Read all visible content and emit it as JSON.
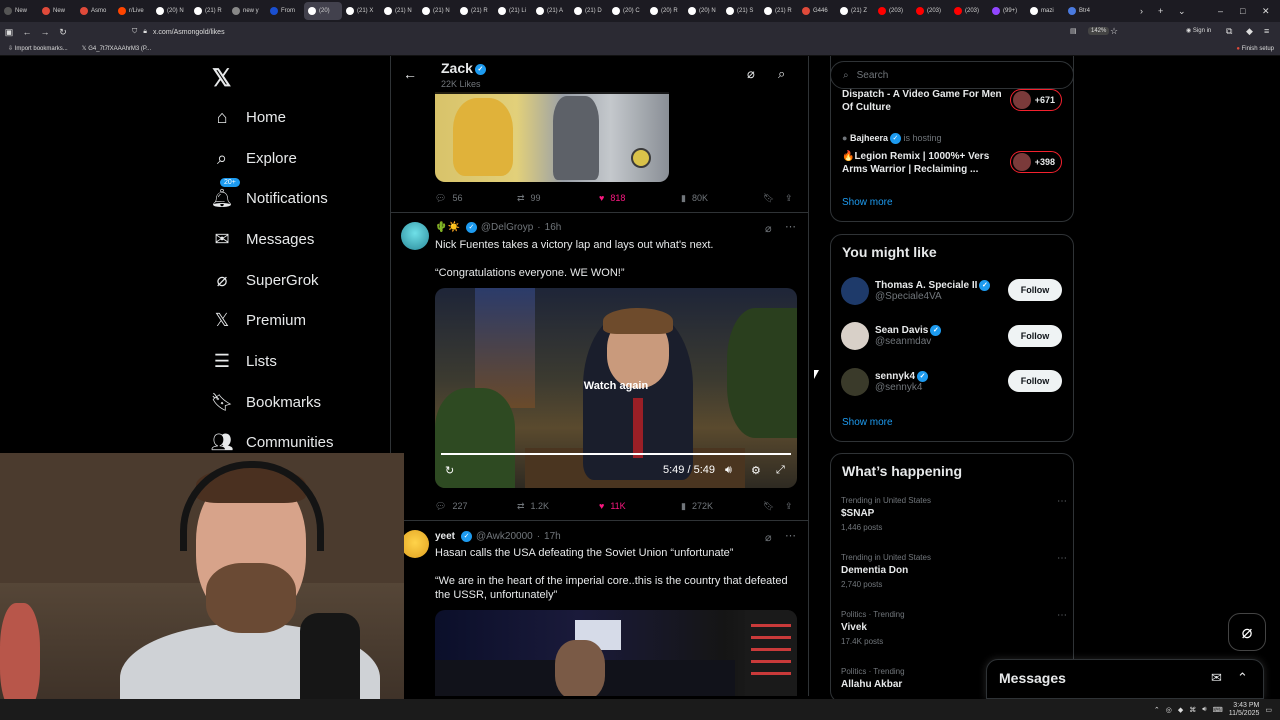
{
  "browser": {
    "tabs": [
      "New",
      "New",
      "Asmo",
      "r/Live",
      "(20) N",
      "(21) R",
      "new y",
      "From",
      "(20)",
      "(21) X",
      "(21) N",
      "(21) N",
      "(21) R",
      "(21) Li",
      "(21) A",
      "(21) D",
      "(20) C",
      "(20) R",
      "(20) N",
      "(21) S",
      "(21) R",
      "G446",
      "(21) Z",
      "(203)",
      "(203)",
      "(203)",
      "(99+)",
      "mazi",
      "Btr4"
    ],
    "url": "x.com/Asmongold/likes",
    "zoom": "142%",
    "sign_in": "Sign in",
    "bookmarks": [
      "Import bookmarks...",
      "G4_7t7fXAAAhrM3 (P..."
    ],
    "finish_setup": "Finish setup"
  },
  "nav": {
    "items": [
      {
        "label": "Home",
        "icon": "home-icon"
      },
      {
        "label": "Explore",
        "icon": "search-icon"
      },
      {
        "label": "Notifications",
        "icon": "bell-icon"
      },
      {
        "label": "Messages",
        "icon": "mail-icon"
      },
      {
        "label": "SuperGrok",
        "icon": "grok-icon"
      },
      {
        "label": "Premium",
        "icon": "x-icon"
      },
      {
        "label": "Lists",
        "icon": "list-icon"
      },
      {
        "label": "Bookmarks",
        "icon": "bookmark-icon"
      },
      {
        "label": "Communities",
        "icon": "people-icon"
      }
    ],
    "notif_badge": "20+"
  },
  "header": {
    "name": "Zack",
    "likes": "22K Likes"
  },
  "tweet0": {
    "replies": "56",
    "retweets": "99",
    "likes": "818",
    "views": "80K"
  },
  "tweet1": {
    "emoji": "🌵☀️",
    "handle": "@DelGroyp",
    "time": "16h",
    "text": "Nick Fuentes takes a victory lap and lays out what's next.",
    "quote": "“Congratulations everyone. WE WON!”",
    "video_overlay": "Watch again",
    "video_time": "5:49 / 5:49",
    "replies": "227",
    "retweets": "1.2K",
    "likes": "11K",
    "views": "272K"
  },
  "tweet2": {
    "name": "yeet",
    "handle": "@Awk20000",
    "time": "17h",
    "text": "Hasan calls the USA defeating the Soviet Union “unfortunate”",
    "quote": "“We are in the heart of the imperial core..this is the country that defeated the USSR, unfortunately”"
  },
  "right": {
    "search_placeholder": "Search",
    "space1": {
      "title": "Dispatch - A Video Game For Men Of Culture",
      "count": "+671"
    },
    "space2": {
      "host": "Bajheera",
      "hosting": "is hosting",
      "title": "🔥Legion Remix | 1000%+ Vers Arms Warrior | Reclaiming ...",
      "count": "+398"
    },
    "show_more": "Show more",
    "wtf_title": "You might like",
    "wtf": [
      {
        "name": "Thomas A. Speciale II",
        "handle": "@Speciale4VA",
        "follow": "Follow"
      },
      {
        "name": "Sean Davis",
        "handle": "@seanmdav",
        "follow": "Follow"
      },
      {
        "name": "sennyk4",
        "handle": "@sennyk4",
        "follow": "Follow"
      }
    ],
    "happening_title": "What’s happening",
    "trends": [
      {
        "context": "Trending in United States",
        "name": "$SNAP",
        "posts": "1,446 posts"
      },
      {
        "context": "Trending in United States",
        "name": "Dementia Don",
        "posts": "2,740 posts"
      },
      {
        "context": "Politics · Trending",
        "name": "Vivek",
        "posts": "17.4K posts"
      },
      {
        "context": "Politics · Trending",
        "name": "Allahu Akbar",
        "posts": ""
      }
    ],
    "messages": "Messages"
  },
  "taskbar": {
    "time": "3:43 PM",
    "date": "11/5/2025"
  },
  "colors": {
    "accent": "#1d9bf0",
    "like": "#f91880",
    "background": "#000000"
  }
}
